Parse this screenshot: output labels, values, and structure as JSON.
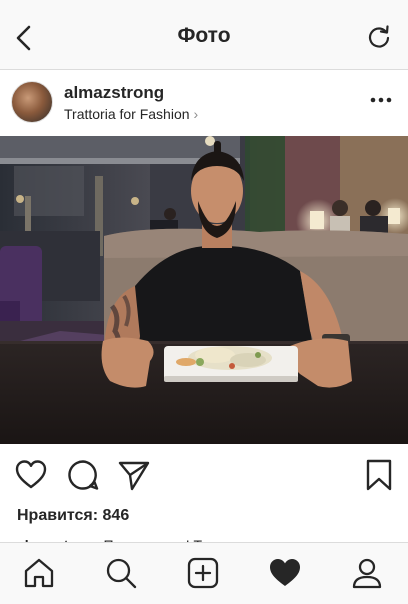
{
  "header": {
    "title": "Фото"
  },
  "post": {
    "username": "almazstrong",
    "location": "Trattoria for Fashion",
    "location_chevron": "›",
    "likes": "Нравится: 846",
    "caption_user": "almazstrong",
    "caption_text": "Привет всем! Теперь вы"
  },
  "icons": {
    "back": "chevron-left-icon",
    "refresh": "refresh-icon",
    "more": "more-options-icon",
    "like": "heart-outline-icon",
    "comment": "comment-icon",
    "share": "paper-plane-icon",
    "save": "bookmark-icon",
    "home": "home-icon",
    "search": "search-icon",
    "add": "add-post-icon",
    "activity": "heart-filled-icon",
    "profile": "profile-icon"
  },
  "colors": {
    "bar_bg": "#f9f9f9",
    "text": "#262626",
    "divider": "#dcdcdc"
  }
}
